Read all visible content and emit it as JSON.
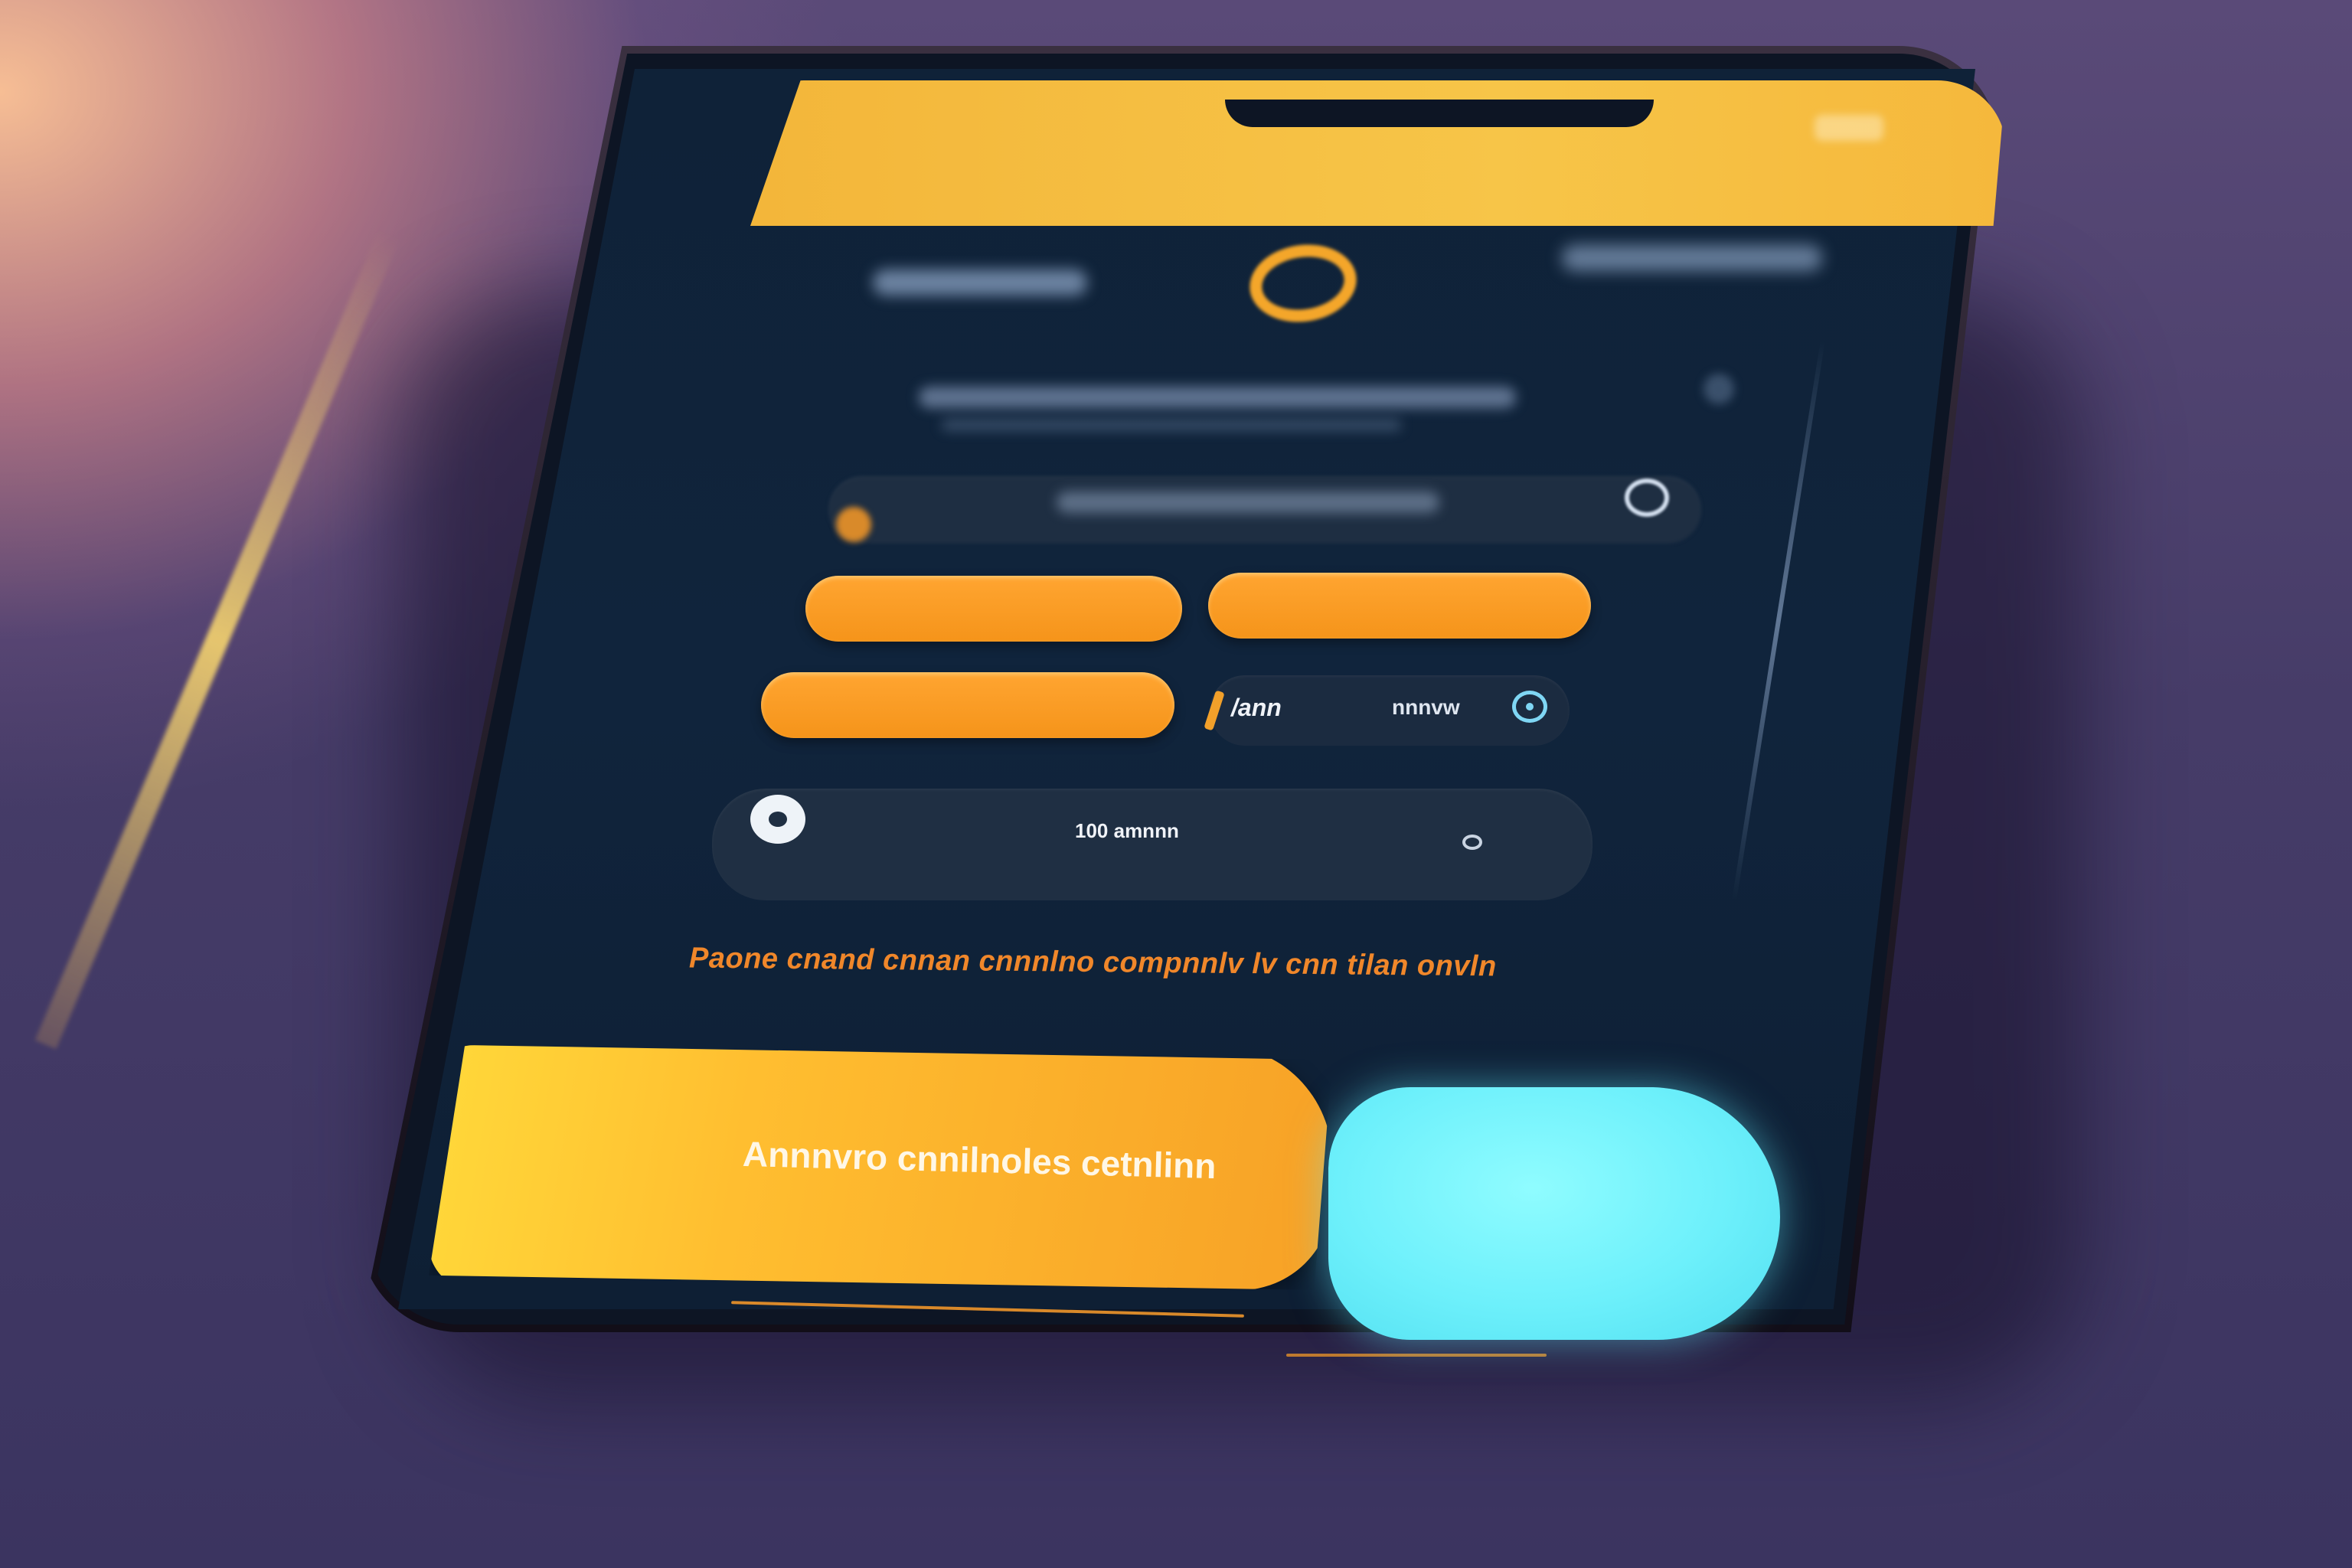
{
  "colors": {
    "accent_orange": "#f7a126",
    "accent_yellow": "#f7c548",
    "accent_cyan": "#6df0fb",
    "screen_bg": "#10243c",
    "field_bg": "#1e2e42"
  },
  "icons": {
    "logo": "ring-logo-icon",
    "search_field_left": "pin-icon",
    "search_field_right": "toggle-icon",
    "input_right": "info-circle-icon",
    "card_left": "play-circle-icon",
    "card_right": "chevron-icon"
  },
  "input_field": {
    "prefix": "/ann",
    "value": "nnnvw"
  },
  "card": {
    "label": "100 amnnn"
  },
  "notice": {
    "text": "Paone cnand cnnan cnnnlno compnnlv lv cnn tilan onvln"
  },
  "primary_button": {
    "label": "Annnvro cnnilnoles cetnlinn"
  }
}
